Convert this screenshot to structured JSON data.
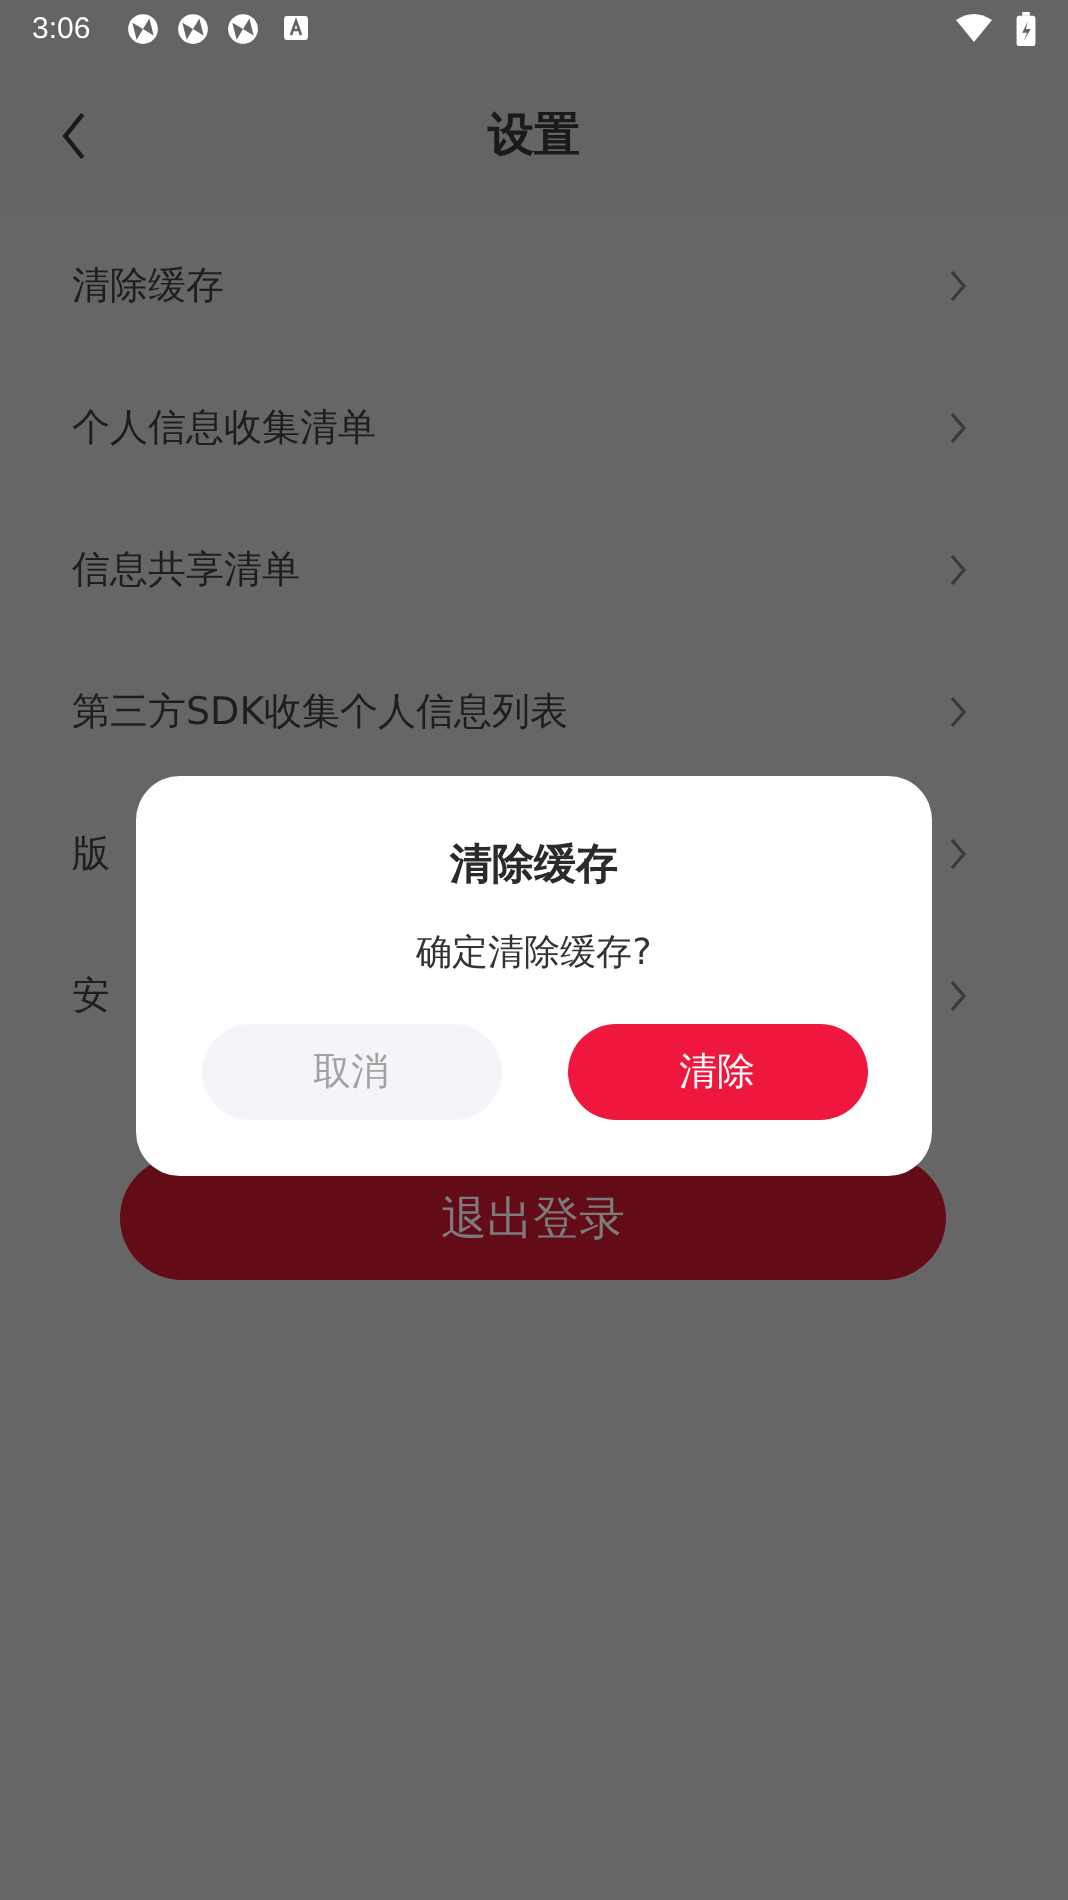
{
  "status_bar": {
    "time": "3:06"
  },
  "app_bar": {
    "title": "设置"
  },
  "settings": [
    {
      "label": "清除缓存"
    },
    {
      "label": "个人信息收集清单"
    },
    {
      "label": "信息共享清单"
    },
    {
      "label": "第三方SDK收集个人信息列表"
    },
    {
      "label": "版"
    },
    {
      "label": "安"
    }
  ],
  "logout_button": "退出登录",
  "dialog": {
    "title": "清除缓存",
    "message": "确定清除缓存?",
    "buttons": [
      {
        "label": "取消",
        "kind": "cancel"
      },
      {
        "label": "清除",
        "kind": "confirm"
      }
    ]
  }
}
